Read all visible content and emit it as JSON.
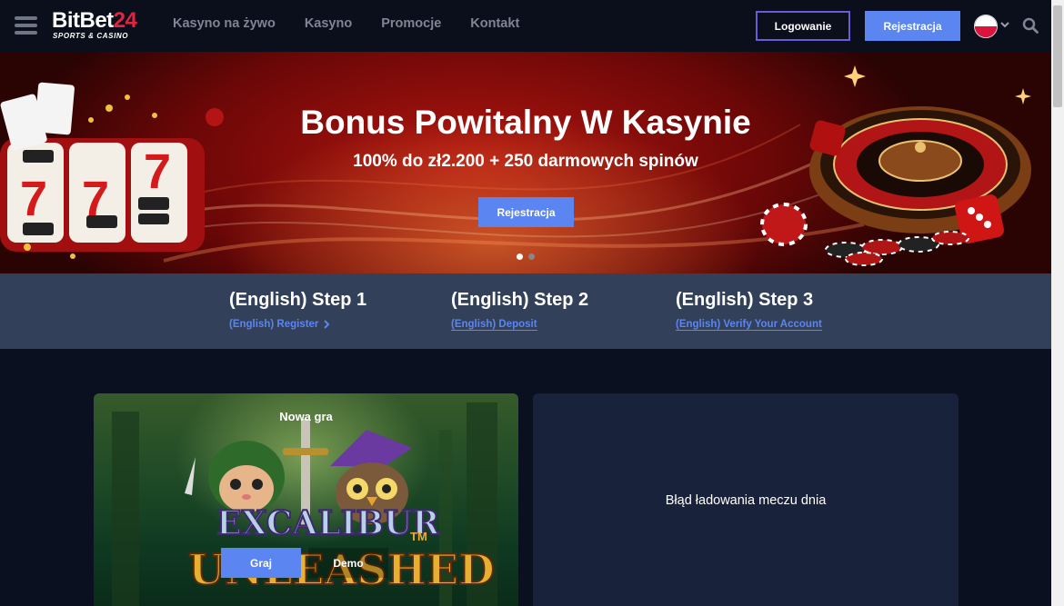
{
  "header": {
    "logo": {
      "main": "BitBet",
      "accent": "24",
      "tagline": "SPORTS & CASINO"
    },
    "nav": [
      "Kasyno na żywo",
      "Kasyno",
      "Promocje",
      "Kontakt"
    ],
    "login_label": "Logowanie",
    "register_label": "Rejestracja",
    "language": "pl"
  },
  "hero": {
    "title": "Bonus Powitalny W Kasynie",
    "subtitle": "100% do zł2.200 + 250 darmowych spinów",
    "cta_label": "Rejestracja",
    "slides": 2,
    "active_slide": 1
  },
  "steps": [
    {
      "title": "(English) Step 1",
      "link": "(English) Register"
    },
    {
      "title": "(English) Step 2",
      "link": "(English) Deposit"
    },
    {
      "title": "(English) Step 3",
      "link": "(English) Verify Your Account"
    }
  ],
  "featured_game": {
    "badge": "Nowa gra",
    "play_label": "Graj",
    "demo_label": "Demo",
    "logo_line1": "EXCALIBUR",
    "logo_line2": "UNLEASHED",
    "trademark": "TM"
  },
  "match_of_day": {
    "message": "Błąd ładowania meczu dnia"
  },
  "colors": {
    "accent_blue": "#5b86f1",
    "brand_red": "#e5233f",
    "login_border": "#6a5bd6",
    "steps_bg": "#33405a",
    "page_bg": "#0b1020"
  }
}
